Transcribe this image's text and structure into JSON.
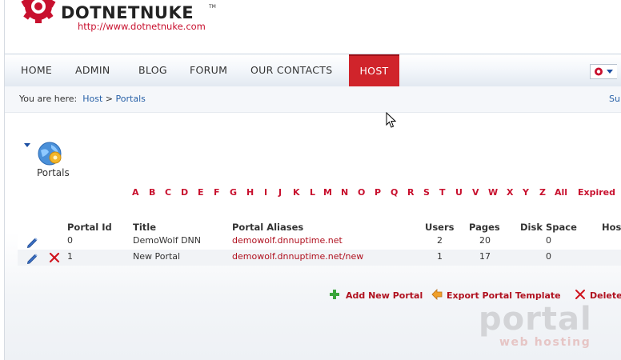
{
  "logo": {
    "name": "DOTNETNUKE",
    "tm": "TM",
    "url": "http://www.dotnetnuke.com"
  },
  "nav": {
    "items": [
      {
        "label": "HOME"
      },
      {
        "label": "ADMIN"
      },
      {
        "label": "BLOG"
      },
      {
        "label": "FORUM"
      },
      {
        "label": "OUR CONTACTS"
      },
      {
        "label": "HOST"
      }
    ],
    "active": "HOST"
  },
  "breadcrumb": {
    "prefix": "You are here:",
    "host": "Host",
    "separator": ">",
    "current": "Portals",
    "right_link": "Su"
  },
  "module": {
    "title": "Portals",
    "icon": "portals-globe-gear-icon"
  },
  "letter_filter": {
    "letters": [
      "A",
      "B",
      "C",
      "D",
      "E",
      "F",
      "G",
      "H",
      "I",
      "J",
      "K",
      "L",
      "M",
      "N",
      "O",
      "P",
      "Q",
      "R",
      "S",
      "T",
      "U",
      "V",
      "W",
      "X",
      "Y",
      "Z",
      "All",
      "Expired"
    ]
  },
  "table": {
    "headers": {
      "portal_id": "Portal Id",
      "title": "Title",
      "aliases": "Portal Aliases",
      "users": "Users",
      "pages": "Pages",
      "disk": "Disk Space",
      "hos": "Hos"
    },
    "rows": [
      {
        "id": "0",
        "title": "DemoWolf DNN",
        "alias": "demowolf.dnnuptime.net",
        "users": "2",
        "pages": "20",
        "disk": "0",
        "deletable": false
      },
      {
        "id": "1",
        "title": "New Portal",
        "alias": "demowolf.dnnuptime.net/new",
        "users": "1",
        "pages": "17",
        "disk": "0",
        "deletable": true
      }
    ]
  },
  "actions": {
    "add": "Add New Portal",
    "export": "Export Portal Template",
    "delete": "Delete"
  },
  "watermark": {
    "big": "portal",
    "small": "web hosting"
  },
  "colors": {
    "brand_red": "#c8102e",
    "active_tab": "#d0242b",
    "link_blue": "#2a62a8"
  }
}
